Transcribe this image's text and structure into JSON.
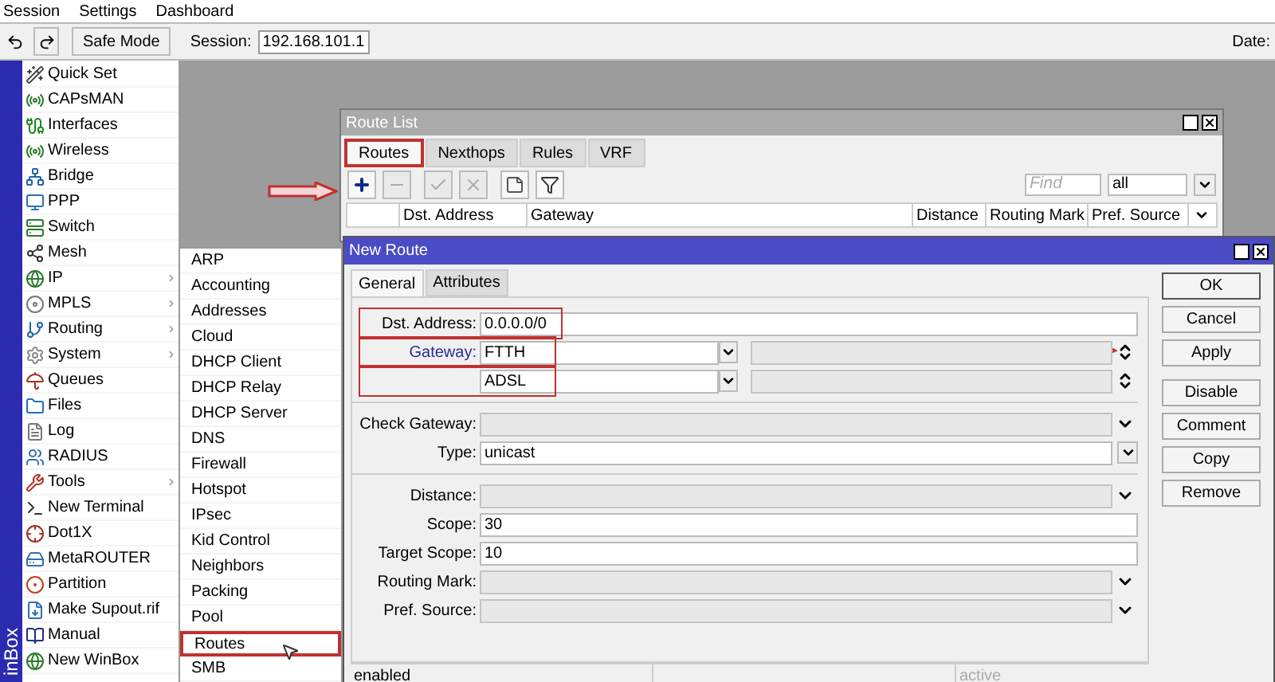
{
  "menu_bar": [
    "Session",
    "Settings",
    "Dashboard"
  ],
  "toolbar": {
    "safe_mode": "Safe Mode",
    "session_label": "Session:",
    "session_value": "192.168.101.1",
    "date_label": "Date:"
  },
  "side_strip": "inBox",
  "sidebar": {
    "items": [
      {
        "label": "Quick Set",
        "submenu": false
      },
      {
        "label": "CAPsMAN",
        "submenu": false
      },
      {
        "label": "Interfaces",
        "submenu": false
      },
      {
        "label": "Wireless",
        "submenu": false
      },
      {
        "label": "Bridge",
        "submenu": false
      },
      {
        "label": "PPP",
        "submenu": false
      },
      {
        "label": "Switch",
        "submenu": false
      },
      {
        "label": "Mesh",
        "submenu": false
      },
      {
        "label": "IP",
        "submenu": true
      },
      {
        "label": "MPLS",
        "submenu": true
      },
      {
        "label": "Routing",
        "submenu": true
      },
      {
        "label": "System",
        "submenu": true
      },
      {
        "label": "Queues",
        "submenu": false
      },
      {
        "label": "Files",
        "submenu": false
      },
      {
        "label": "Log",
        "submenu": false
      },
      {
        "label": "RADIUS",
        "submenu": false
      },
      {
        "label": "Tools",
        "submenu": true
      },
      {
        "label": "New Terminal",
        "submenu": false
      },
      {
        "label": "Dot1X",
        "submenu": false
      },
      {
        "label": "MetaROUTER",
        "submenu": false
      },
      {
        "label": "Partition",
        "submenu": false
      },
      {
        "label": "Make Supout.rif",
        "submenu": false
      },
      {
        "label": "Manual",
        "submenu": false
      },
      {
        "label": "New WinBox",
        "submenu": false
      }
    ]
  },
  "submenu": {
    "items": [
      {
        "label": "ARP",
        "highlighted": false
      },
      {
        "label": "Accounting",
        "highlighted": false
      },
      {
        "label": "Addresses",
        "highlighted": false
      },
      {
        "label": "Cloud",
        "highlighted": false
      },
      {
        "label": "DHCP Client",
        "highlighted": false
      },
      {
        "label": "DHCP Relay",
        "highlighted": false
      },
      {
        "label": "DHCP Server",
        "highlighted": false
      },
      {
        "label": "DNS",
        "highlighted": false
      },
      {
        "label": "Firewall",
        "highlighted": false
      },
      {
        "label": "Hotspot",
        "highlighted": false
      },
      {
        "label": "IPsec",
        "highlighted": false
      },
      {
        "label": "Kid Control",
        "highlighted": false
      },
      {
        "label": "Neighbors",
        "highlighted": false
      },
      {
        "label": "Packing",
        "highlighted": false
      },
      {
        "label": "Pool",
        "highlighted": false
      },
      {
        "label": "Routes",
        "highlighted": true
      },
      {
        "label": "SMB",
        "highlighted": false
      }
    ]
  },
  "route_list": {
    "title": "Route List",
    "tabs": [
      {
        "label": "Routes",
        "selected": true,
        "highlighted": true
      },
      {
        "label": "Nexthops",
        "selected": false,
        "highlighted": false
      },
      {
        "label": "Rules",
        "selected": false,
        "highlighted": false
      },
      {
        "label": "VRF",
        "selected": false,
        "highlighted": false
      }
    ],
    "tools": [
      {
        "kind": "add",
        "disabled": false
      },
      {
        "kind": "remove",
        "disabled": true
      },
      {
        "kind": "enable",
        "disabled": true
      },
      {
        "kind": "disable",
        "disabled": true
      },
      {
        "kind": "comment",
        "disabled": false
      },
      {
        "kind": "filter",
        "disabled": false
      }
    ],
    "find": {
      "placeholder": "Find"
    },
    "filter_value": "all",
    "columns": [
      "Dst. Address",
      "Gateway",
      "Distance",
      "Routing Mark",
      "Pref. Source"
    ]
  },
  "new_route": {
    "title": "New Route",
    "tabs": [
      {
        "label": "General",
        "selected": true
      },
      {
        "label": "Attributes",
        "selected": false
      }
    ],
    "groups": [
      [
        {
          "kind": "text",
          "label": "Dst. Address:",
          "value": "0.0.0.0/0",
          "highlighted": true
        },
        {
          "kind": "gateway",
          "label": "Gateway:",
          "value": "FTTH",
          "highlighted": true
        },
        {
          "kind": "gateway",
          "value": "ADSL",
          "highlighted": true
        }
      ],
      [
        {
          "kind": "select",
          "label": "Check Gateway:",
          "highlighted": false
        },
        {
          "kind": "combo",
          "label": "Type:",
          "value": "unicast",
          "highlighted": false
        }
      ],
      [
        {
          "kind": "select",
          "label": "Distance:",
          "highlighted": false
        },
        {
          "kind": "text",
          "label": "Scope:",
          "value": "30",
          "highlighted": false
        },
        {
          "kind": "text",
          "label": "Target Scope:",
          "value": "10",
          "highlighted": false
        },
        {
          "kind": "select",
          "label": "Routing Mark:",
          "highlighted": false
        },
        {
          "kind": "select",
          "label": "Pref. Source:",
          "highlighted": false
        }
      ]
    ],
    "buttons": [
      "OK",
      "Cancel",
      "Apply",
      "Disable",
      "Comment",
      "Copy",
      "Remove"
    ],
    "status_bar": {
      "left": "enabled",
      "right": "active"
    }
  }
}
